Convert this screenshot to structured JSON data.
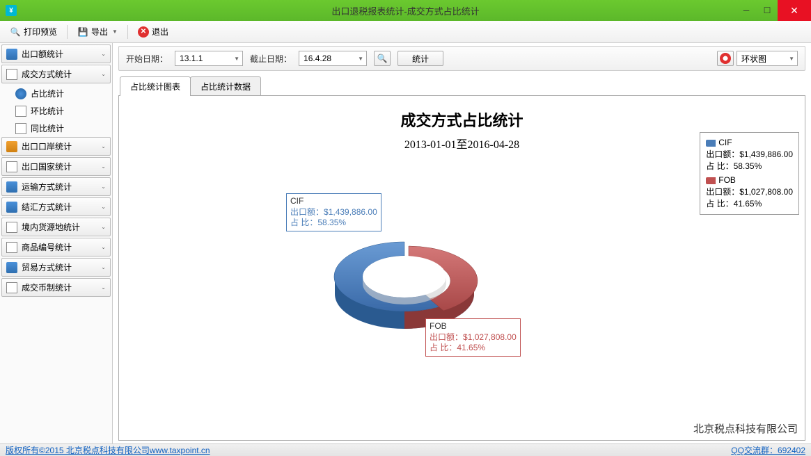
{
  "window": {
    "title": "出口退税报表统计-成交方式占比统计"
  },
  "toolbar": {
    "preview": "打印预览",
    "export": "导出",
    "exit": "退出"
  },
  "sidebar": {
    "groups": [
      {
        "label": "出口额统计"
      },
      {
        "label": "成交方式统计",
        "subs": [
          {
            "label": "占比统计"
          },
          {
            "label": "环比统计"
          },
          {
            "label": "同比统计"
          }
        ]
      },
      {
        "label": "出口口岸统计"
      },
      {
        "label": "出口国家统计"
      },
      {
        "label": "运输方式统计"
      },
      {
        "label": "结汇方式统计"
      },
      {
        "label": "境内货源地统计"
      },
      {
        "label": "商品编号统计"
      },
      {
        "label": "贸易方式统计"
      },
      {
        "label": "成交币制统计"
      }
    ]
  },
  "filter": {
    "start_label": "开始日期：",
    "start_value": "13.1.1",
    "end_label": "截止日期：",
    "end_value": "16.4.28",
    "stat_btn": "统计",
    "chart_type": "环状图"
  },
  "tabs": {
    "chart": "占比统计图表",
    "data": "占比统计数据"
  },
  "chart": {
    "title": "成交方式占比统计",
    "subtitle": "2013-01-01至2016-04-28",
    "cif_name": "CIF",
    "cif_amount_label": "出口额：",
    "cif_amount": "$1,439,886.00",
    "cif_pct_label": "占   比：",
    "cif_pct": "58.35%",
    "fob_name": "FOB",
    "fob_amount_label": "出口额：",
    "fob_amount": "$1,027,808.00",
    "fob_pct_label": "占   比：",
    "fob_pct": "41.65%",
    "company": "北京税点科技有限公司"
  },
  "chart_data": {
    "type": "pie",
    "title": "成交方式占比统计",
    "subtitle": "2013-01-01至2016-04-28",
    "series": [
      {
        "name": "CIF",
        "value": 1439886.0,
        "percent": 58.35,
        "color": "#4a7db8"
      },
      {
        "name": "FOB",
        "value": 1027808.0,
        "percent": 41.65,
        "color": "#c05050"
      }
    ]
  },
  "status": {
    "copyright": "版权所有©2015 北京税点科技有限公司www.taxpoint.cn",
    "qq": "QQ交流群：692402"
  }
}
